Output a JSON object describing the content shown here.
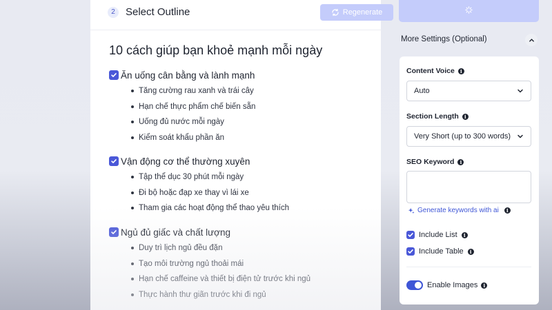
{
  "step": {
    "number": "2",
    "title": "Select Outline",
    "regenerate_label": "Regenerate"
  },
  "outline": {
    "title": "10 cách giúp bạn khoẻ mạnh mỗi ngày",
    "sections": [
      {
        "title": "Ăn uống cân bằng và lành mạnh",
        "checked": true,
        "items": [
          "Tăng cường rau xanh và trái cây",
          "Hạn chế thực phẩm chế biến sẵn",
          "Uống đủ nước mỗi ngày",
          "Kiểm soát khẩu phần ăn"
        ]
      },
      {
        "title": "Vận động cơ thể thường xuyên",
        "checked": true,
        "items": [
          "Tập thể dục 30 phút mỗi ngày",
          "Đi bộ hoặc đạp xe thay vì lái xe",
          "Tham gia các hoạt động thể thao yêu thích"
        ]
      },
      {
        "title": "Ngủ đủ giấc và chất lượng",
        "checked": true,
        "items": [
          "Duy trì lịch ngủ đều đặn",
          "Tạo môi trường ngủ thoải mái",
          "Hạn chế caffeine và thiết bị điện tử trước khi ngủ",
          "Thực hành thư giãn trước khi đi ngủ"
        ]
      }
    ]
  },
  "settings": {
    "header": "More Settings (Optional)",
    "content_voice": {
      "label": "Content Voice",
      "value": "Auto"
    },
    "section_length": {
      "label": "Section Length",
      "value": "Very Short (up to 300 words)"
    },
    "seo_keyword": {
      "label": "SEO Keyword",
      "value": "",
      "generate_link": "Generate keywords with ai"
    },
    "include_list": {
      "label": "Include List",
      "checked": true
    },
    "include_table": {
      "label": "Include Table",
      "checked": true
    },
    "enable_images": {
      "label": "Enable Images",
      "on": true
    }
  },
  "colors": {
    "accent": "#4a58d8",
    "accent_light": "#c4ccfb",
    "link": "#3f56d6"
  },
  "icons": [
    "refresh-icon",
    "spinner-icon",
    "chevron-up-icon",
    "chevron-down-icon",
    "info-icon",
    "sparkle-icon",
    "check-icon"
  ]
}
